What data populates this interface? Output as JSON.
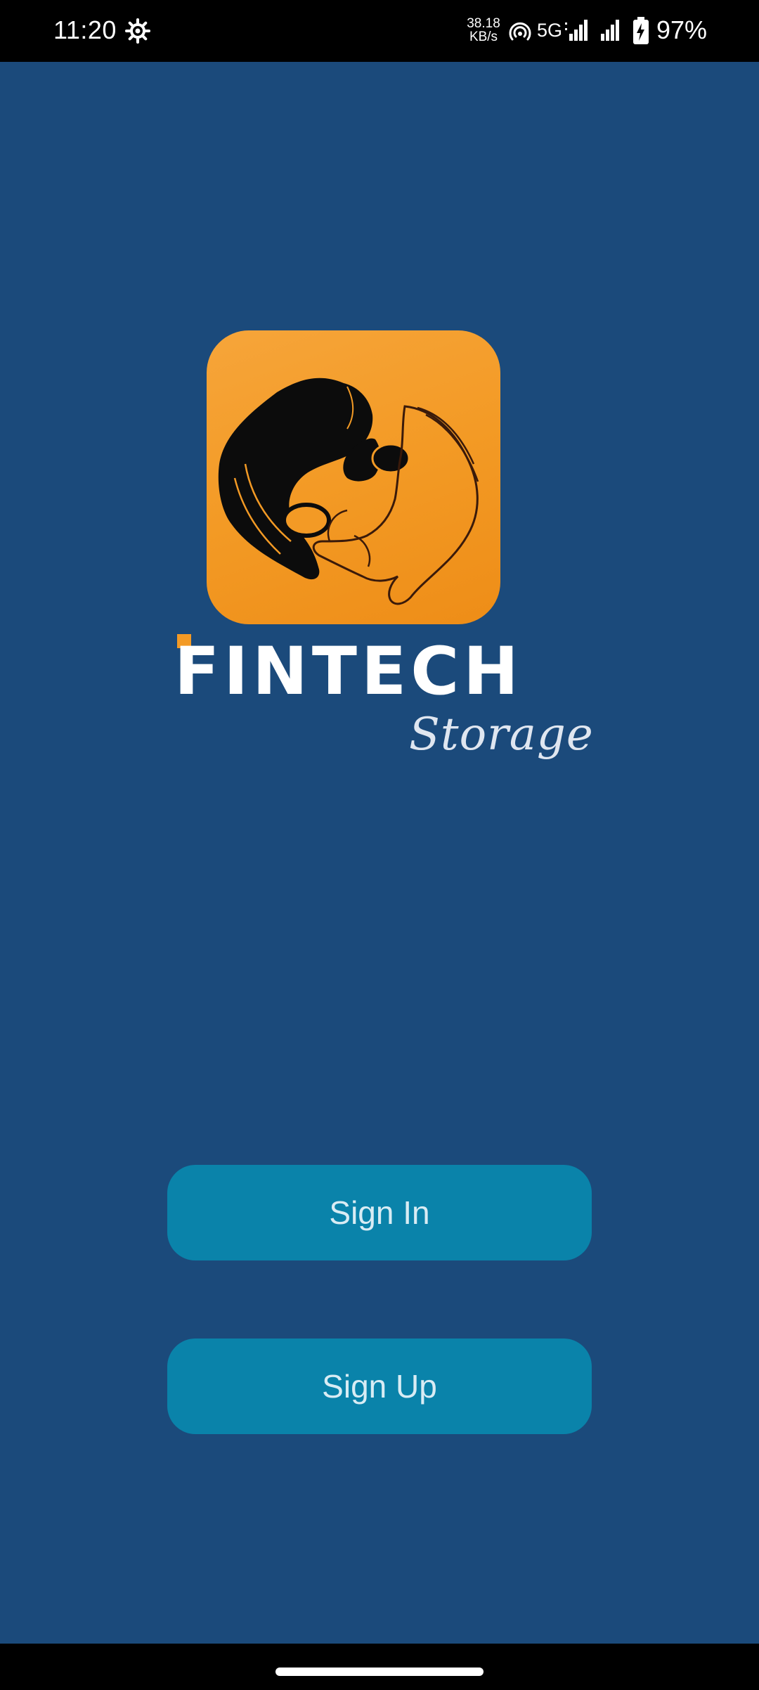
{
  "status_bar": {
    "time": "11:20",
    "net_speed_value": "38.18",
    "net_speed_unit": "KB/s",
    "network_type": "5G",
    "battery_percent": "97%",
    "icons": [
      "gear-icon",
      "hotspot-icon",
      "signal-icon",
      "signal-icon",
      "battery-charging-icon"
    ]
  },
  "logo": {
    "wordmark": "FINTECH",
    "script_word": "Storage"
  },
  "actions": {
    "sign_in_label": "Sign In",
    "sign_up_label": "Sign Up"
  },
  "colors": {
    "background": "#1b4a7b",
    "button": "#0a83aa",
    "brand_orange": "#f39a25"
  }
}
